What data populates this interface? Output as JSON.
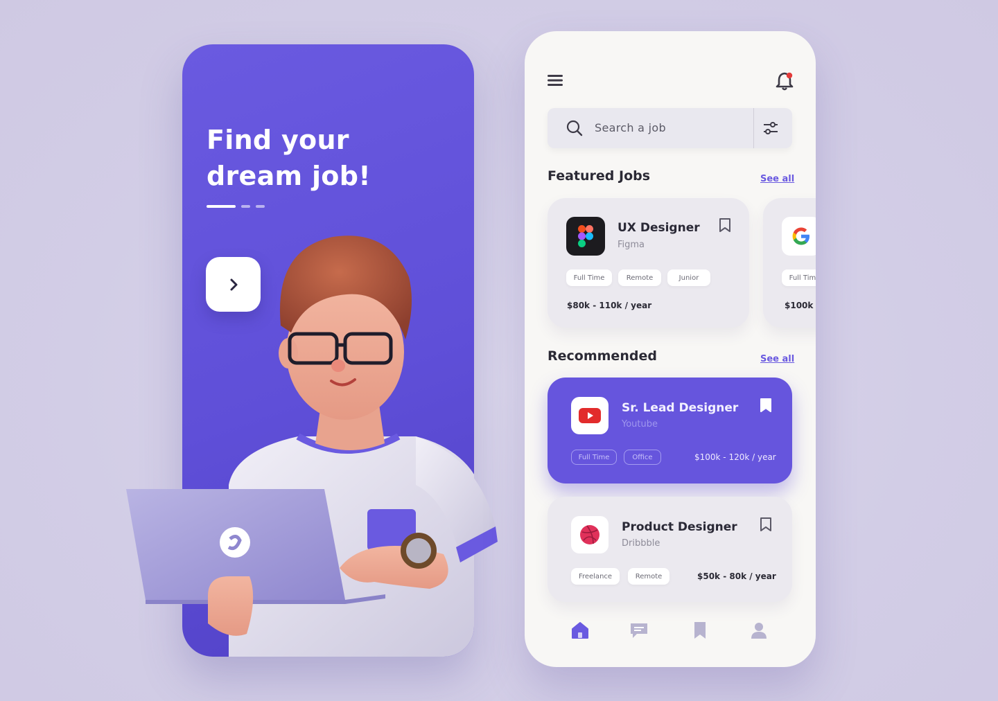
{
  "onboarding": {
    "title_line1": "Find your",
    "title_line2": "dream job!",
    "next_icon": "chevron-right-icon"
  },
  "home": {
    "menu_icon": "hamburger-menu-icon",
    "notification_icon": "bell-icon",
    "search": {
      "placeholder": "Search a job",
      "icon": "search-icon",
      "filter_icon": "sliders-icon"
    },
    "featured": {
      "title": "Featured Jobs",
      "see_all": "See all",
      "cards": [
        {
          "title": "UX Designer",
          "company": "Figma",
          "logo": "figma-logo",
          "tags": [
            "Full Time",
            "Remote",
            "Junior"
          ],
          "salary": "$80k - 110k / year",
          "bookmarked": false
        },
        {
          "title": "",
          "company": "",
          "logo": "google-logo",
          "tags": [
            "Full Time"
          ],
          "salary": "$100k -"
        }
      ]
    },
    "recommended": {
      "title": "Recommended",
      "see_all": "See all",
      "cards": [
        {
          "title": "Sr. Lead Designer",
          "company": "Youtube",
          "logo": "youtube-logo",
          "tags": [
            "Full Time",
            "Office"
          ],
          "salary": "$100k - 120k / year",
          "bookmarked": true,
          "accent": "#6655dd"
        },
        {
          "title": "Product Designer",
          "company": "Dribbble",
          "logo": "dribbble-logo",
          "tags": [
            "Freelance",
            "Remote"
          ],
          "salary": "$50k - 80k / year",
          "bookmarked": false
        }
      ]
    },
    "bottom_nav": [
      {
        "icon": "home-icon",
        "active": true
      },
      {
        "icon": "chat-icon",
        "active": false
      },
      {
        "icon": "bookmark-icon",
        "active": false
      },
      {
        "icon": "profile-icon",
        "active": false
      }
    ]
  },
  "colors": {
    "accent": "#6655dd",
    "background": "#d6d1e8",
    "card": "#ebe9ef"
  }
}
